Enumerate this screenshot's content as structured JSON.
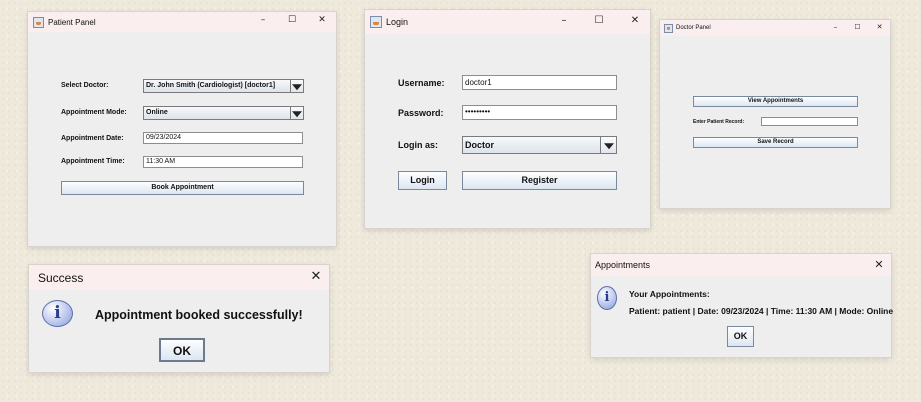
{
  "patient_panel": {
    "title": "Patient Panel",
    "select_doctor_label": "Select Doctor:",
    "select_doctor_value": "Dr. John Smith (Cardiologist) [doctor1]",
    "appointment_mode_label": "Appointment Mode:",
    "appointment_mode_value": "Online",
    "appointment_date_label": "Appointment Date:",
    "appointment_date_value": "09/23/2024",
    "appointment_time_label": "Appointment Time:",
    "appointment_time_value": "11:30 AM",
    "book_button": "Book Appointment"
  },
  "login": {
    "title": "Login",
    "username_label": "Username:",
    "username_value": "doctor1",
    "password_label": "Password:",
    "password_value": "•••••••••",
    "login_as_label": "Login as:",
    "login_as_value": "Doctor",
    "login_button": "Login",
    "register_button": "Register"
  },
  "doctor_panel": {
    "title": "Doctor Panel",
    "view_button": "View Appointments",
    "record_label": "Enter Patient Record:",
    "record_value": "",
    "save_button": "Save Record"
  },
  "success_dialog": {
    "title": "Success",
    "message": "Appointment booked successfully!",
    "ok_button": "OK"
  },
  "appointments_dialog": {
    "title": "Appointments",
    "heading": "Your Appointments:",
    "detail": "Patient: patient | Date: 09/23/2024 | Time: 11:30 AM | Mode: Online",
    "ok_button": "OK"
  },
  "window_controls": {
    "minimize": "–",
    "maximize": "☐",
    "close": "✕"
  },
  "icons": {
    "java": "java-cup-icon",
    "info": "information-icon",
    "dropdown": "chevron-down-icon"
  },
  "colors": {
    "titlebar": "#fbeeee",
    "window": "#eeeeee",
    "button_gradient_top": "#fdfeff",
    "button_gradient_bottom": "#dce6f1"
  }
}
